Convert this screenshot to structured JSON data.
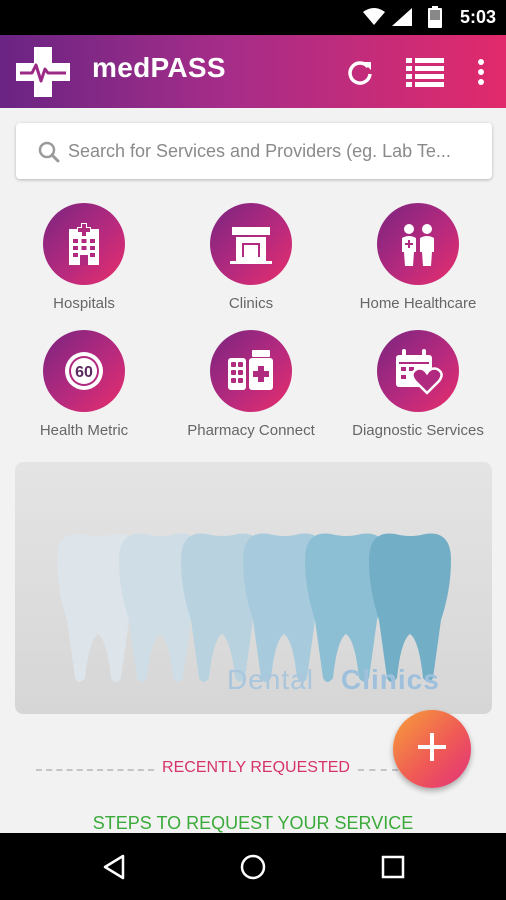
{
  "status_bar": {
    "time": "5:03",
    "icons": [
      "wifi-icon",
      "signal-icon",
      "battery-icon"
    ]
  },
  "app_bar": {
    "title": "medPASS",
    "logo_icon": "medical-cross-logo",
    "actions": [
      "refresh-icon",
      "list-icon",
      "more-vert-icon"
    ],
    "gradient": [
      "#6a2483",
      "#e12a6b"
    ]
  },
  "search": {
    "placeholder": "Search for Services and Providers (eg. Lab Te...",
    "value": ""
  },
  "categories": [
    {
      "label": "Hospitals",
      "icon": "hospital-icon"
    },
    {
      "label": "Clinics",
      "icon": "clinic-icon"
    },
    {
      "label": "Home Healthcare",
      "icon": "home-healthcare-icon"
    },
    {
      "label": "Health Metric",
      "icon": "health-metric-icon",
      "badge": "60"
    },
    {
      "label": "Pharmacy Connect",
      "icon": "pharmacy-icon"
    },
    {
      "label": "Diagnostic Services",
      "icon": "diagnostic-icon"
    }
  ],
  "banner": {
    "text_light": "Dental",
    "text_bold": "Clinics"
  },
  "recently_requested": "RECENTLY REQUESTED",
  "steps": "STEPS TO REQUEST YOUR SERVICE",
  "fab": {
    "icon": "plus-icon"
  },
  "nav_bar": {
    "buttons": [
      "back-icon",
      "home-icon",
      "recents-icon"
    ]
  },
  "colors": {
    "accent": "#e12a6b",
    "primary": "#6a2483",
    "recent_text": "#d6336c",
    "steps_text": "#3aab3a"
  }
}
